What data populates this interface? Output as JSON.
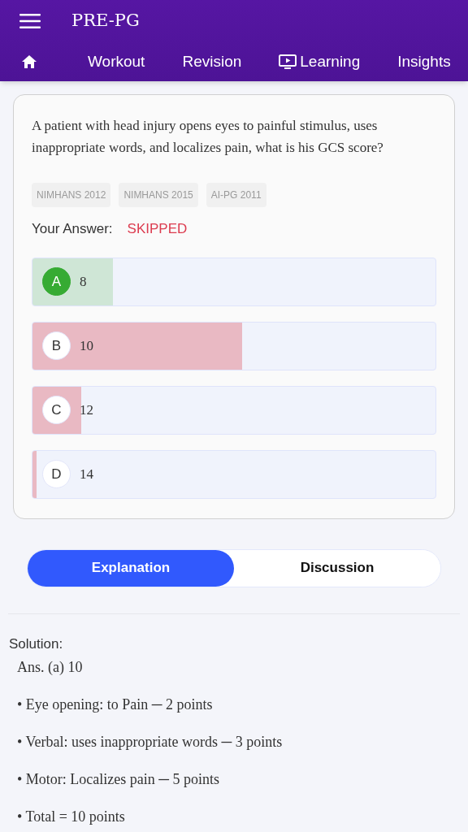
{
  "app_bar": {
    "title": "PRE-PG"
  },
  "nav": [
    {
      "kind": "home"
    },
    {
      "kind": "text",
      "label": "Workout"
    },
    {
      "kind": "text",
      "label": "Revision"
    },
    {
      "kind": "video",
      "label": "Learning"
    },
    {
      "kind": "text",
      "label": "Insights"
    }
  ],
  "question": {
    "text": "A patient with head injury opens eyes to painful stimulus, uses inappropriate words, and localizes pain, what is his GCS score?",
    "tags": [
      "NIMHANS 2012",
      "NIMHANS 2015",
      "AI-PG 2011"
    ],
    "answer_label": "Your Answer:",
    "answer_value": "SKIPPED",
    "options": [
      {
        "letter": "A",
        "text": "8",
        "correct": true,
        "level": 0.2
      },
      {
        "letter": "B",
        "text": "10",
        "correct": false,
        "level": 0.52
      },
      {
        "letter": "C",
        "text": "12",
        "correct": false,
        "level": 0.12
      },
      {
        "letter": "D",
        "text": "14",
        "correct": false,
        "level": 0.01
      }
    ]
  },
  "tabs": [
    {
      "label": "Explanation",
      "selected": true
    },
    {
      "label": "Discussion",
      "selected": false
    }
  ],
  "solution": {
    "heading": "Solution:",
    "answer": "Ans. (a) 10",
    "points": [
      "• Eye opening: to Pain ─ 2 points",
      "• Verbal: uses inappropriate words ─ 3 points",
      "• Motor: Localizes pain ─ 5 points",
      "• Total = 10 points"
    ]
  }
}
